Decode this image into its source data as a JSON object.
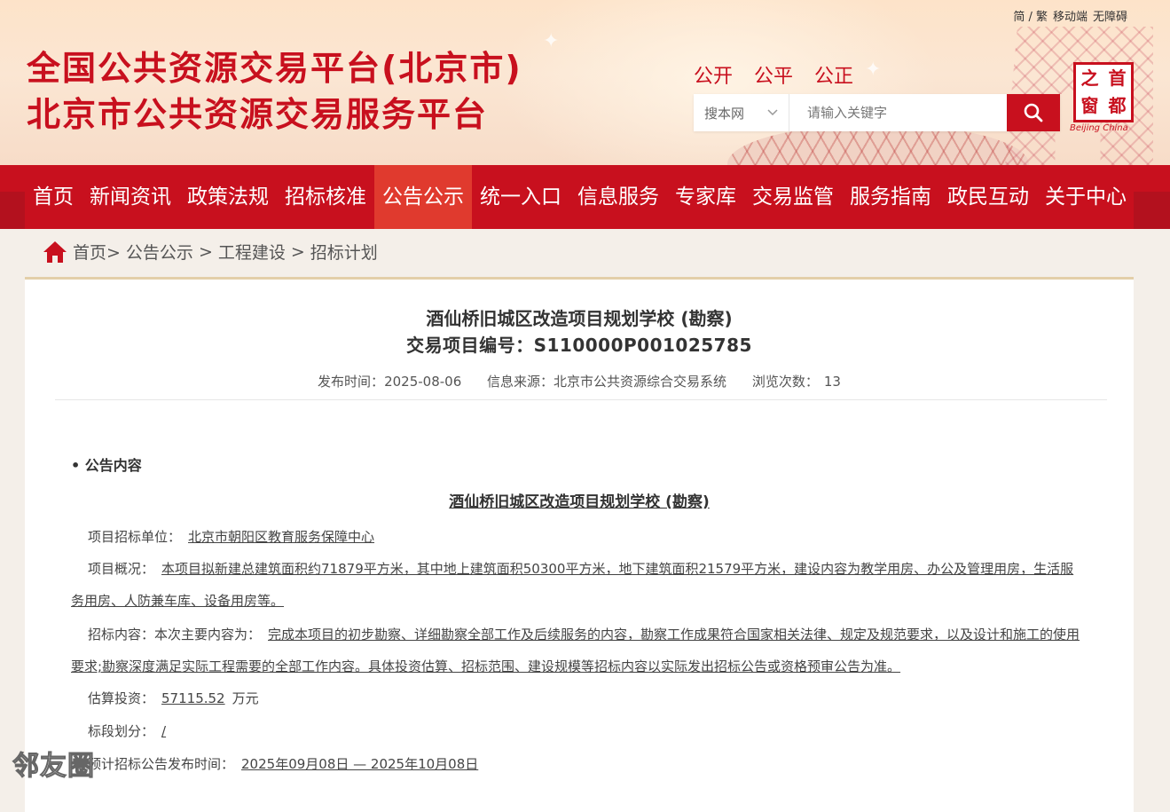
{
  "header": {
    "title_line1": "全国公共资源交易平台(北京市)",
    "title_line2": "北京市公共资源交易服务平台",
    "top_links": [
      "简 / 繁",
      "移动端",
      "无障碍"
    ],
    "slogans": [
      "公开",
      "公平",
      "公正"
    ],
    "search": {
      "scope": "搜本网",
      "placeholder": "请输入关键字"
    },
    "seal": {
      "chars": [
        "之",
        "首",
        "窗",
        "都"
      ],
      "subtitle": "Beijing China"
    }
  },
  "nav": {
    "items": [
      "首页",
      "新闻资讯",
      "政策法规",
      "招标核准",
      "公告公示",
      "统一入口",
      "信息服务",
      "专家库",
      "交易监管",
      "服务指南",
      "政民互动",
      "关于中心"
    ]
  },
  "breadcrumb": {
    "home": "首页>",
    "c1": "公告公示",
    "sep1": ">",
    "c2": "工程建设",
    "sep2": ">",
    "c3": "招标计划"
  },
  "article": {
    "title": "酒仙桥旧城区改造项目规划学校 (勘察)",
    "code": "交易项目编号：S110000P001025785",
    "meta": {
      "date_label": "发布时间：",
      "date": "2025-08-06",
      "source_label": "信息来源：",
      "source": "北京市公共资源综合交易系统",
      "views_label": "浏览次数：",
      "views": "13"
    },
    "section_head": "• 公告内容",
    "inner_title": "酒仙桥旧城区改造项目规划学校 (勘察)",
    "fields": {
      "unit_label": "项目招标单位：",
      "unit_value": "北京市朝阳区教育服务保障中心",
      "overview_label": "项目概况：",
      "overview_value": "本项目拟新建总建筑面积约71879平方米，其中地上建筑面积50300平方米，地下建筑面积21579平方米，建设内容为教学用房、办公及管理用房，生活服务用房、人防兼车库、设备用房等。",
      "content_label": "招标内容：本次主要内容为：",
      "content_value": "完成本项目的初步勘察、详细勘察全部工作及后续服务的内容，勘察工作成果符合国家相关法律、规定及规范要求，以及设计和施工的使用要求;勘察深度满足实际工程需要的全部工作内容。具体投资估算、招标范围、建设规模等招标内容以实际发出招标公告或资格预审公告为准。",
      "invest_label": "估算投资：",
      "invest_value": "57115.52",
      "invest_unit": "万元",
      "section_label": "标段划分：",
      "section_value": "/",
      "plan_label": "预计招标公告发布时间：",
      "plan_value": "2025年09月08日 — 2025年10月08日"
    }
  },
  "watermark": "邻友圈",
  "colors": {
    "brand_red": "#c8101e",
    "nav_active": "#e03a2e",
    "page_bg": "#f4efe9"
  }
}
